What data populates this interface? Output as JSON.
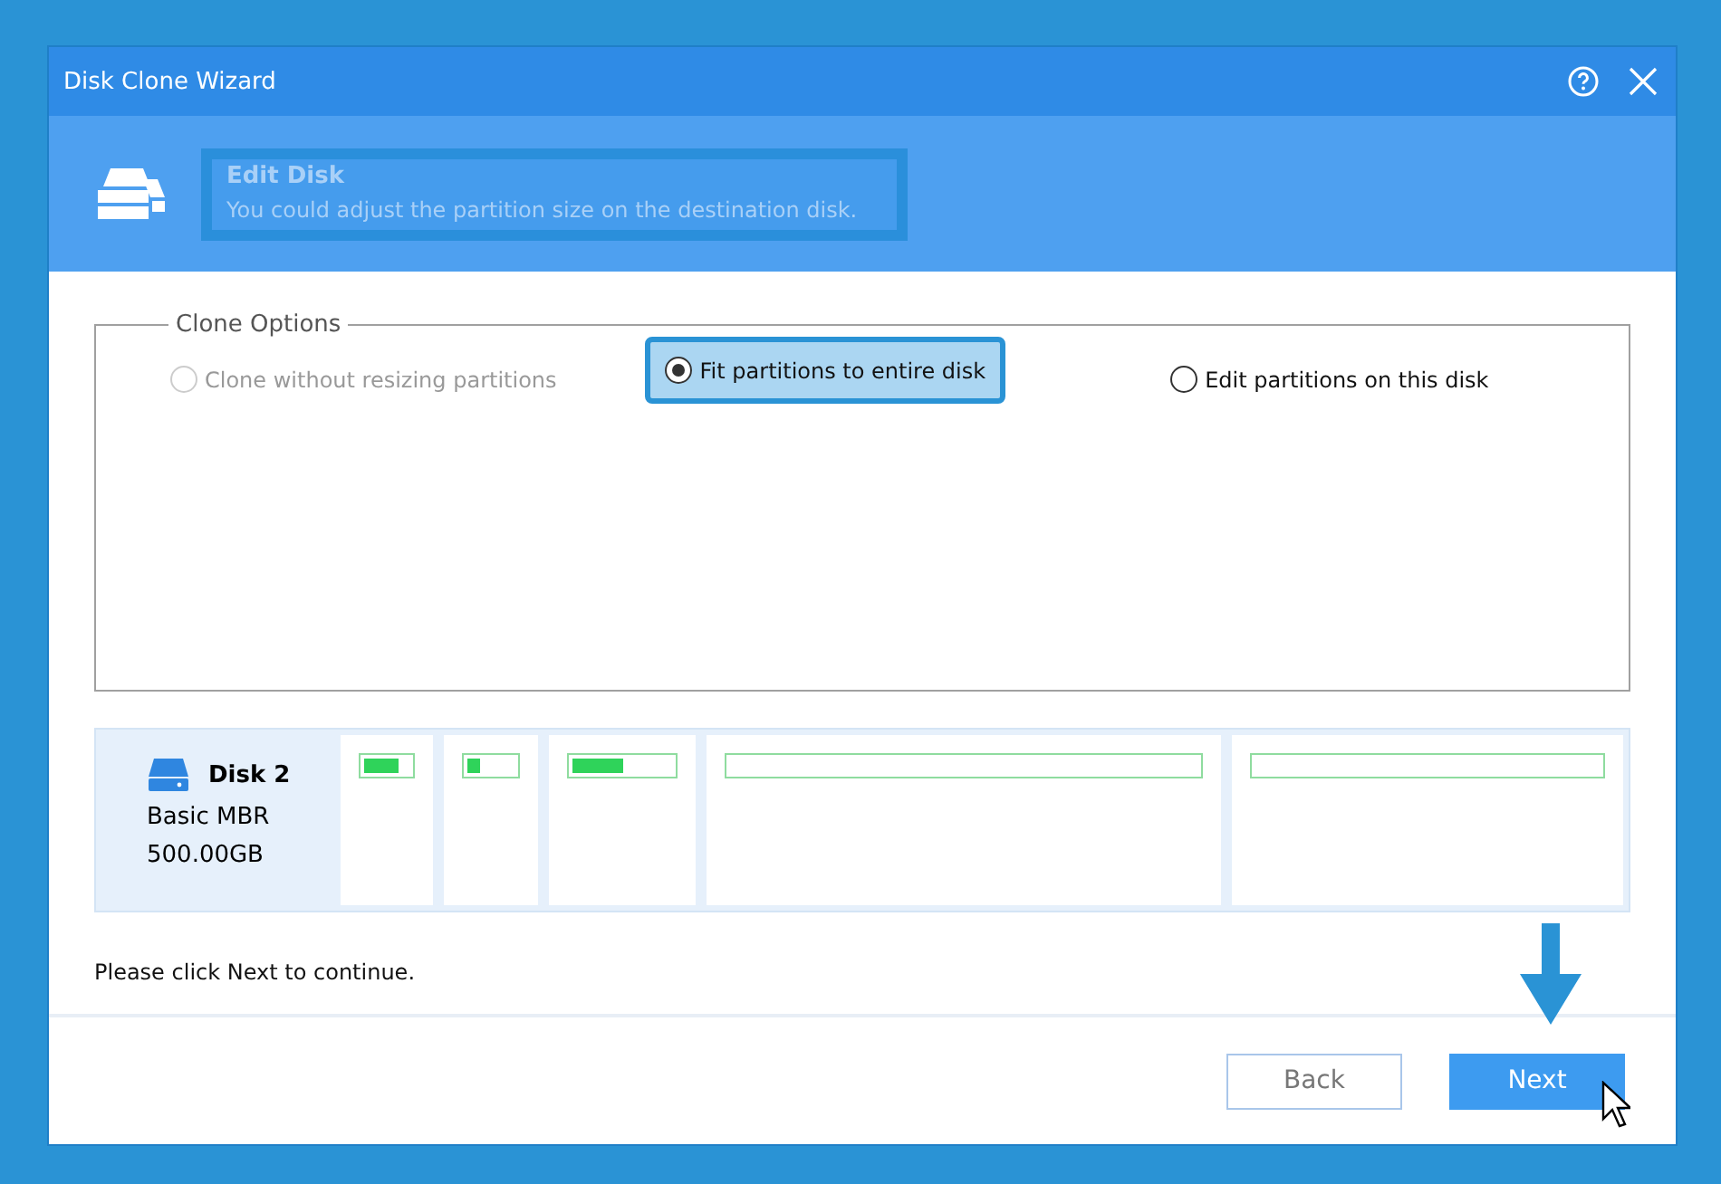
{
  "window": {
    "title": "Disk Clone Wizard"
  },
  "header": {
    "title": "Edit Disk",
    "subtitle": "You could adjust the partition size on the destination disk."
  },
  "clone_options": {
    "legend": "Clone Options",
    "options": [
      {
        "label": "Clone without resizing partitions",
        "selected": false,
        "disabled": true
      },
      {
        "label": "Fit partitions to entire disk",
        "selected": true,
        "disabled": false
      },
      {
        "label": "Edit partitions on this disk",
        "selected": false,
        "disabled": false
      }
    ]
  },
  "disk": {
    "name": "Disk 2",
    "type": "Basic MBR",
    "size": "500.00GB",
    "partitions": [
      {
        "kind": "used",
        "level": 0.75
      },
      {
        "kind": "used",
        "level": 0.25
      },
      {
        "kind": "used",
        "level": 0.5
      },
      {
        "kind": "empty"
      },
      {
        "kind": "empty"
      }
    ]
  },
  "hint": "Please click Next to continue.",
  "buttons": [
    {
      "label": "Back",
      "kind": "secondary"
    },
    {
      "label": "Next",
      "kind": "primary"
    }
  ]
}
